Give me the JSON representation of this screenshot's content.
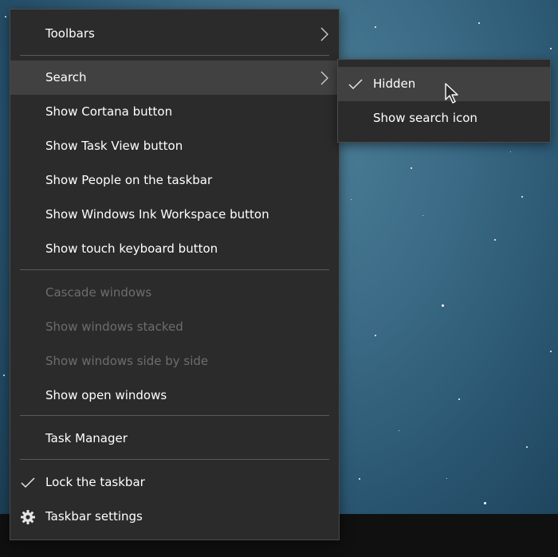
{
  "context_menu": {
    "items": [
      {
        "label": "Toolbars"
      },
      {
        "label": "Search"
      },
      {
        "label": "Show Cortana button"
      },
      {
        "label": "Show Task View button"
      },
      {
        "label": "Show People on the taskbar"
      },
      {
        "label": "Show Windows Ink Workspace button"
      },
      {
        "label": "Show touch keyboard button"
      },
      {
        "label": "Cascade windows"
      },
      {
        "label": "Show windows stacked"
      },
      {
        "label": "Show windows side by side"
      },
      {
        "label": "Show open windows"
      },
      {
        "label": "Task Manager"
      },
      {
        "label": "Lock the taskbar",
        "checked": true
      },
      {
        "label": "Taskbar settings",
        "icon": "gear-icon"
      }
    ],
    "disabled_items": [
      "Cascade windows",
      "Show windows stacked",
      "Show windows side by side"
    ],
    "highlighted_item": "Search"
  },
  "search_submenu": {
    "items": [
      {
        "label": "Hidden",
        "checked": true
      },
      {
        "label": "Show search icon"
      }
    ],
    "highlighted_item": "Hidden"
  },
  "colors": {
    "menu_bg": "#2b2b2b",
    "hover_bg": "#414141",
    "text": "#ffffff",
    "disabled_text": "#6d6d6d",
    "separator": "#5a5a5a",
    "taskbar": "#101010"
  }
}
